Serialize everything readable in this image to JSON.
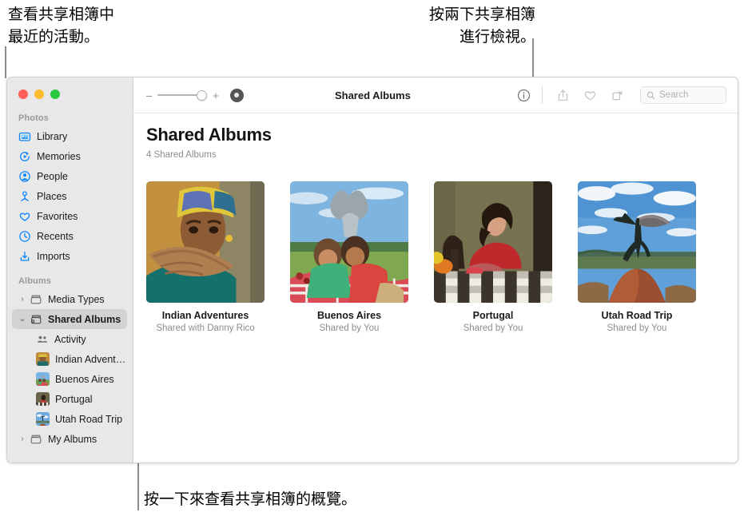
{
  "annotations": {
    "top_left": "查看共享相簿中\n最近的活動。",
    "top_middle": "按兩下共享相簿\n進行檢視。",
    "bottom": "按一下來查看共享相簿的概覽。"
  },
  "window": {
    "traffic_lights": [
      "close",
      "minimize",
      "zoom"
    ]
  },
  "sidebar": {
    "sections": [
      {
        "header": "Photos",
        "items": [
          {
            "label": "Library",
            "icon": "library-icon"
          },
          {
            "label": "Memories",
            "icon": "memories-icon"
          },
          {
            "label": "People",
            "icon": "people-icon"
          },
          {
            "label": "Places",
            "icon": "places-icon"
          },
          {
            "label": "Favorites",
            "icon": "heart-icon"
          },
          {
            "label": "Recents",
            "icon": "clock-icon"
          },
          {
            "label": "Imports",
            "icon": "import-icon"
          }
        ]
      },
      {
        "header": "Albums",
        "items": [
          {
            "label": "Media Types",
            "icon": "album-icon",
            "disclosure": "collapsed"
          },
          {
            "label": "Shared Albums",
            "icon": "shared-album-icon",
            "disclosure": "expanded",
            "selected": true
          },
          {
            "label": "Activity",
            "icon": "activity-icon"
          },
          {
            "label": "Indian Advent…",
            "icon": "album-thumb"
          },
          {
            "label": "Buenos Aires",
            "icon": "album-thumb"
          },
          {
            "label": "Portugal",
            "icon": "album-thumb"
          },
          {
            "label": "Utah Road Trip",
            "icon": "album-thumb"
          },
          {
            "label": "My Albums",
            "icon": "album-icon",
            "disclosure": "collapsed"
          }
        ]
      }
    ]
  },
  "toolbar": {
    "zoom_minus": "–",
    "zoom_plus": "+",
    "title": "Shared Albums",
    "info_icon": "info-icon",
    "share_icon": "share-icon",
    "favorite_icon": "heart-icon",
    "rotate_icon": "rotate-icon",
    "search_placeholder": "Search"
  },
  "main": {
    "title": "Shared Albums",
    "subtitle": "4 Shared Albums",
    "albums": [
      {
        "name": "Indian Adventures",
        "sub": "Shared with Danny Rico"
      },
      {
        "name": "Buenos Aires",
        "sub": "Shared by You"
      },
      {
        "name": "Portugal",
        "sub": "Shared by You"
      },
      {
        "name": "Utah Road Trip",
        "sub": "Shared by You"
      }
    ]
  },
  "colors": {
    "accent": "#0a84ff",
    "sidebar_bg": "#e8e8e8",
    "selected_bg": "#d2d2d2",
    "leader_line": "#8b8b8b"
  }
}
